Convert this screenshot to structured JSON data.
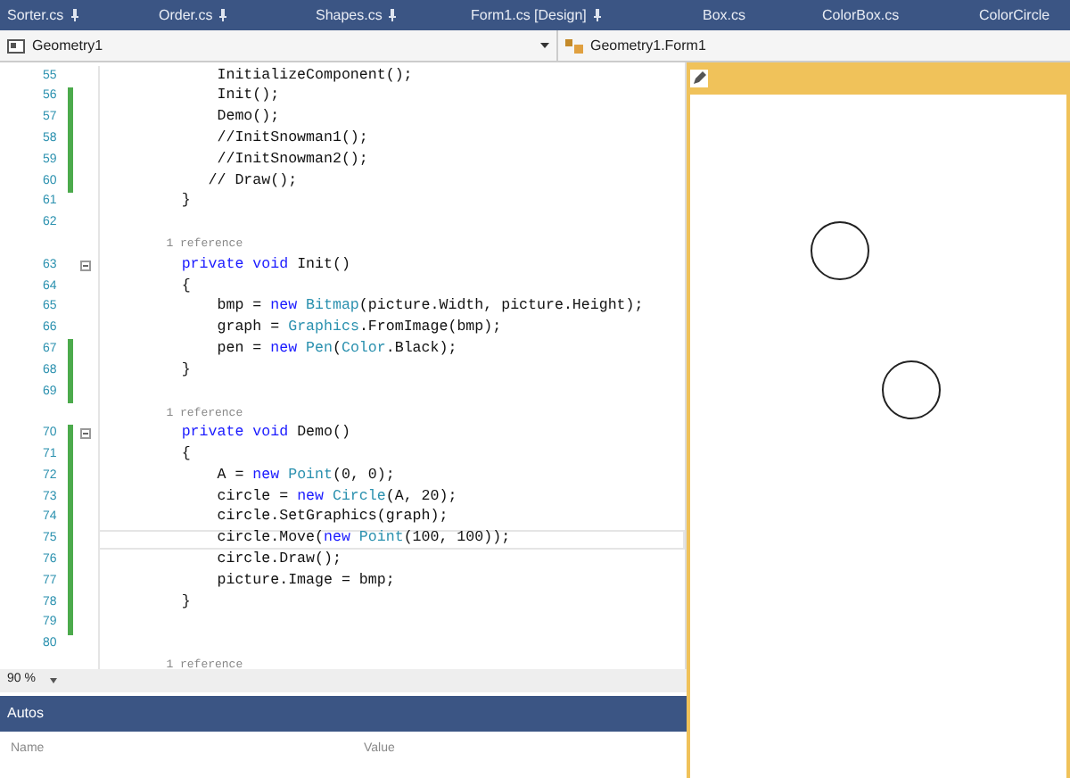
{
  "tabs": [
    {
      "label": "Sorter.cs",
      "pinned": true
    },
    {
      "label": "Order.cs",
      "pinned": true
    },
    {
      "label": "Shapes.cs",
      "pinned": true
    },
    {
      "label": "Form1.cs [Design]",
      "pinned": true
    },
    {
      "label": "Box.cs",
      "pinned": false
    },
    {
      "label": "ColorBox.cs",
      "pinned": false
    },
    {
      "label": "ColorCircle",
      "pinned": false
    }
  ],
  "nav_bar": {
    "project": "Geometry1",
    "member": "Geometry1.Form1"
  },
  "editor": {
    "lines": [
      {
        "kind": "code",
        "number": "55",
        "changed": false,
        "fold": false,
        "current": false,
        "segments": [
          {
            "text": "            InitializeComponent();",
            "kind": "plain"
          }
        ]
      },
      {
        "kind": "code",
        "number": "56",
        "changed": true,
        "fold": false,
        "current": false,
        "segments": [
          {
            "text": "            Init();",
            "kind": "plain"
          }
        ]
      },
      {
        "kind": "code",
        "number": "57",
        "changed": true,
        "fold": false,
        "current": false,
        "segments": [
          {
            "text": "            Demo();",
            "kind": "plain"
          }
        ]
      },
      {
        "kind": "code",
        "number": "58",
        "changed": true,
        "fold": false,
        "current": false,
        "segments": [
          {
            "text": "            //InitSnowman1();",
            "kind": "plain"
          }
        ]
      },
      {
        "kind": "code",
        "number": "59",
        "changed": true,
        "fold": false,
        "current": false,
        "segments": [
          {
            "text": "            //InitSnowman2();",
            "kind": "plain"
          }
        ]
      },
      {
        "kind": "code",
        "number": "60",
        "changed": true,
        "fold": false,
        "current": false,
        "segments": [
          {
            "text": "           // Draw();",
            "kind": "plain"
          }
        ]
      },
      {
        "kind": "code",
        "number": "61",
        "changed": false,
        "fold": false,
        "current": false,
        "segments": [
          {
            "text": "        }",
            "kind": "plain"
          }
        ]
      },
      {
        "kind": "code",
        "number": "62",
        "changed": false,
        "fold": false,
        "current": false
      },
      {
        "kind": "reference",
        "text": "        1 reference"
      },
      {
        "kind": "code",
        "number": "63",
        "changed": false,
        "fold": true,
        "current": false,
        "segments": [
          {
            "text": "        private void",
            "kind": "keyword"
          },
          {
            "text": " Init()",
            "kind": "plain"
          }
        ]
      },
      {
        "kind": "code",
        "number": "64",
        "changed": false,
        "fold": false,
        "current": false,
        "segments": [
          {
            "text": "        {",
            "kind": "plain"
          }
        ]
      },
      {
        "kind": "code",
        "number": "65",
        "changed": false,
        "fold": false,
        "current": false,
        "segments": [
          {
            "text": "            bmp = ",
            "kind": "plain"
          },
          {
            "text": "new",
            "kind": "keyword"
          },
          {
            "text": " Bitmap",
            "kind": "type"
          },
          {
            "text": "(picture.Width, picture.Height);",
            "kind": "plain"
          }
        ]
      },
      {
        "kind": "code",
        "number": "66",
        "changed": false,
        "fold": false,
        "current": false,
        "segments": [
          {
            "text": "            graph = ",
            "kind": "plain"
          },
          {
            "text": "Graphics",
            "kind": "type"
          },
          {
            "text": ".FromImage(bmp);",
            "kind": "plain"
          }
        ]
      },
      {
        "kind": "code",
        "number": "67",
        "changed": true,
        "fold": false,
        "current": false,
        "segments": [
          {
            "text": "            pen = ",
            "kind": "plain"
          },
          {
            "text": "new",
            "kind": "keyword"
          },
          {
            "text": " Pen",
            "kind": "type"
          },
          {
            "text": "(",
            "kind": "plain"
          },
          {
            "text": "Color",
            "kind": "type"
          },
          {
            "text": ".Black);",
            "kind": "plain"
          }
        ]
      },
      {
        "kind": "code",
        "number": "68",
        "changed": true,
        "fold": false,
        "current": false,
        "segments": [
          {
            "text": "        }",
            "kind": "plain"
          }
        ]
      },
      {
        "kind": "code",
        "number": "69",
        "changed": true,
        "fold": false,
        "current": false
      },
      {
        "kind": "reference",
        "text": "        1 reference"
      },
      {
        "kind": "code",
        "number": "70",
        "changed": true,
        "fold": true,
        "current": false,
        "segments": [
          {
            "text": "        private void",
            "kind": "keyword"
          },
          {
            "text": " Demo()",
            "kind": "plain"
          }
        ]
      },
      {
        "kind": "code",
        "number": "71",
        "changed": true,
        "fold": false,
        "current": false,
        "segments": [
          {
            "text": "        {",
            "kind": "plain"
          }
        ]
      },
      {
        "kind": "code",
        "number": "72",
        "changed": true,
        "fold": false,
        "current": false,
        "segments": [
          {
            "text": "            A = ",
            "kind": "plain"
          },
          {
            "text": "new",
            "kind": "keyword"
          },
          {
            "text": " Point",
            "kind": "type"
          },
          {
            "text": "(0, 0);",
            "kind": "plain"
          }
        ]
      },
      {
        "kind": "code",
        "number": "73",
        "changed": true,
        "fold": false,
        "current": false,
        "segments": [
          {
            "text": "            circle = ",
            "kind": "plain"
          },
          {
            "text": "new",
            "kind": "keyword"
          },
          {
            "text": " Circle",
            "kind": "type"
          },
          {
            "text": "(A, 20);",
            "kind": "plain"
          }
        ]
      },
      {
        "kind": "code",
        "number": "74",
        "changed": true,
        "fold": false,
        "current": false,
        "segments": [
          {
            "text": "            circle.SetGraphics(graph);",
            "kind": "plain"
          }
        ]
      },
      {
        "kind": "code",
        "number": "75",
        "changed": true,
        "fold": false,
        "current": true,
        "segments": [
          {
            "text": "            circle.Move(",
            "kind": "plain"
          },
          {
            "text": "new",
            "kind": "keyword"
          },
          {
            "text": " Point",
            "kind": "type"
          },
          {
            "text": "(100, 100));",
            "kind": "plain"
          }
        ]
      },
      {
        "kind": "code",
        "number": "76",
        "changed": true,
        "fold": false,
        "current": false,
        "segments": [
          {
            "text": "            circle.Draw();",
            "kind": "plain"
          }
        ]
      },
      {
        "kind": "code",
        "number": "77",
        "changed": true,
        "fold": false,
        "current": false,
        "segments": [
          {
            "text": "            picture.Image = bmp;",
            "kind": "plain"
          }
        ]
      },
      {
        "kind": "code",
        "number": "78",
        "changed": true,
        "fold": false,
        "current": false,
        "segments": [
          {
            "text": "        }",
            "kind": "plain"
          }
        ]
      },
      {
        "kind": "code",
        "number": "79",
        "changed": true,
        "fold": false,
        "current": false
      },
      {
        "kind": "code",
        "number": "80",
        "changed": false,
        "fold": false,
        "current": false
      },
      {
        "kind": "reference",
        "text": "        1 reference"
      }
    ]
  },
  "zoom": "90 %",
  "autos": {
    "title": "Autos",
    "columns": [
      "Name",
      "Value"
    ]
  }
}
